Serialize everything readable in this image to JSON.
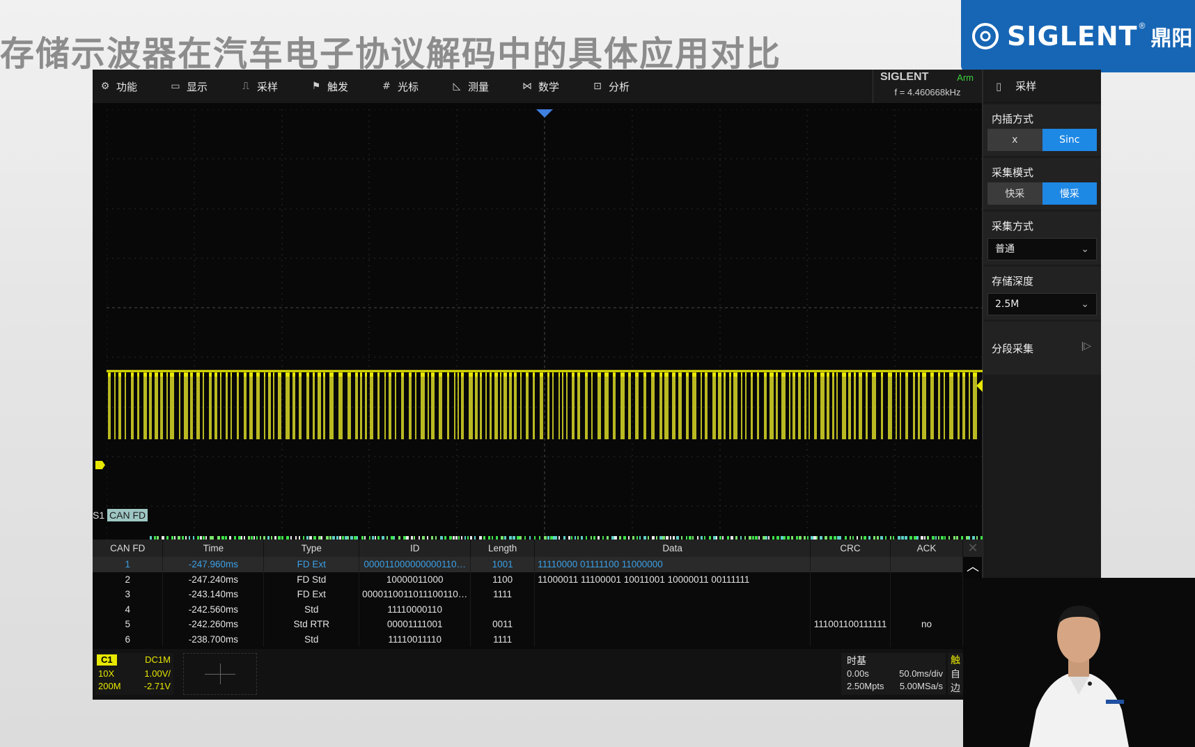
{
  "slide": {
    "title": "存储示波器在汽车电子协议解码中的具体应用对比",
    "logo_brand": "SIGLENT",
    "logo_reg": "®",
    "logo_cn": "鼎阳"
  },
  "scope": {
    "menu": [
      {
        "label": "功能",
        "icon": "gear-icon"
      },
      {
        "label": "显示",
        "icon": "monitor-icon"
      },
      {
        "label": "采样",
        "icon": "sampling-icon"
      },
      {
        "label": "触发",
        "icon": "flag-icon"
      },
      {
        "label": "光标",
        "icon": "cursor-icon"
      },
      {
        "label": "测量",
        "icon": "measure-icon"
      },
      {
        "label": "数学",
        "icon": "math-icon"
      },
      {
        "label": "分析",
        "icon": "analysis-icon"
      }
    ],
    "brand": "SIGLENT",
    "status": "Arm",
    "freq": "f = 4.460668kHz",
    "panel": {
      "title": "采样",
      "interp_label": "内插方式",
      "interp_options": [
        "x",
        "Sinc"
      ],
      "acq_mode_label": "采集模式",
      "acq_mode_options": [
        "快采",
        "慢采"
      ],
      "acq_type_label": "采集方式",
      "acq_type_value": "普通",
      "depth_label": "存储深度",
      "depth_value": "2.5M",
      "segment_label": "分段采集"
    },
    "serial_label": "S1",
    "serial_tag": "CAN FD",
    "decode": {
      "headers": [
        "CAN FD",
        "Time",
        "Type",
        "ID",
        "Length",
        "Data",
        "CRC",
        "ACK"
      ],
      "rows": [
        [
          "1",
          "-247.960ms",
          "FD Ext",
          "000011000000000110…",
          "1001",
          "11110000 01111100 11000000",
          "",
          ""
        ],
        [
          "2",
          "-247.240ms",
          "FD Std",
          "10000011000",
          "1100",
          "11000011 11100001 10011001 10000011 00111111",
          "",
          ""
        ],
        [
          "3",
          "-243.140ms",
          "FD Ext",
          "0000110011011100110…",
          "1111",
          "",
          "",
          ""
        ],
        [
          "4",
          "-242.560ms",
          "Std",
          "11110000110",
          "",
          "",
          "",
          ""
        ],
        [
          "5",
          "-242.260ms",
          "Std RTR",
          "00001111001",
          "0011",
          "",
          "111001100111111",
          "no"
        ],
        [
          "6",
          "-238.700ms",
          "Std",
          "11110011110",
          "1111",
          "",
          "",
          ""
        ]
      ]
    },
    "channel": {
      "name": "C1",
      "coupling": "DC1M",
      "probe": "10X",
      "scale": "1.00V/",
      "bw": "200M",
      "offset": "-2.71V"
    },
    "timebase": {
      "label": "时基",
      "delay": "0.00s",
      "scale": "50.0ms/div",
      "depth": "2.50Mpts",
      "rate": "5.00MSa/s"
    },
    "trigger": {
      "label": "触",
      "line1": "自",
      "line2": "边"
    }
  },
  "colors": {
    "trace": "#e8e800",
    "accent": "#1e88e5",
    "logo_bg": "#1766b5"
  }
}
